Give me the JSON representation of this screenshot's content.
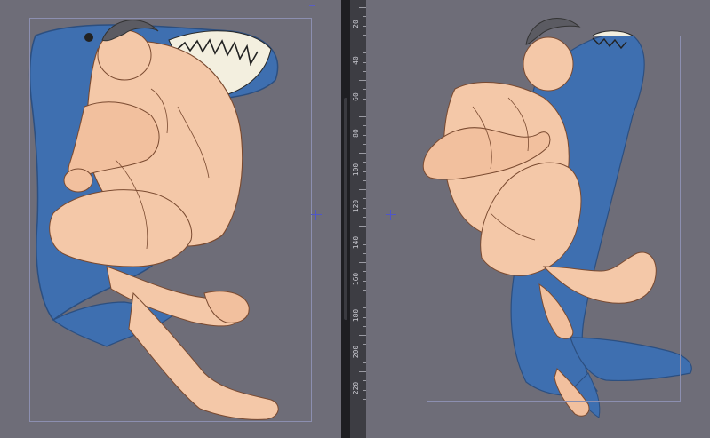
{
  "app": {
    "views": [
      "left-canvas",
      "right-canvas"
    ]
  },
  "ruler": {
    "labels": [
      "20",
      "40",
      "60",
      "80",
      "100",
      "120",
      "140",
      "160",
      "180",
      "200",
      "220"
    ]
  },
  "colors": {
    "canvas_bg": "#6e6d78",
    "shark_blue": "#3e6fb0",
    "skin": "#f4c8a8",
    "guide": "#8c8fb0",
    "marker": "#4f56c9"
  },
  "icons": {
    "center_marker": "crosshair-icon"
  }
}
